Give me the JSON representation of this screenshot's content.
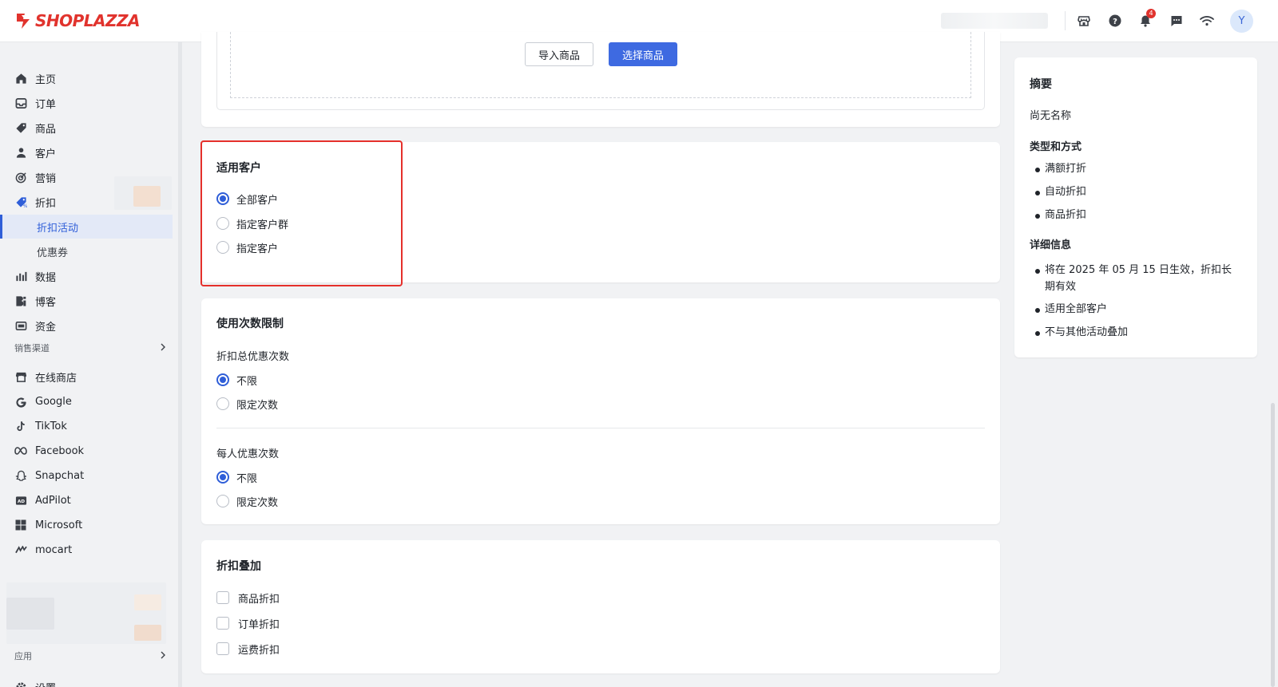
{
  "app": {
    "logo_text": "SHOPLAZZA",
    "brand_color": "#e1332d",
    "accent_color": "#2f5ed8"
  },
  "topbar": {
    "icons": [
      "store-icon",
      "help-icon",
      "bell-icon",
      "chat-icon",
      "wifi-icon"
    ],
    "notification_count": "4",
    "avatar_initial": "Y"
  },
  "sidebar": {
    "items": [
      {
        "label": "主页",
        "icon": "home-icon"
      },
      {
        "label": "订单",
        "icon": "inbox-icon"
      },
      {
        "label": "商品",
        "icon": "tag-icon"
      },
      {
        "label": "客户",
        "icon": "person-icon"
      },
      {
        "label": "营销",
        "icon": "target-icon"
      },
      {
        "label": "折扣",
        "icon": "discount-icon"
      }
    ],
    "sub_items": [
      {
        "label": "折扣活动",
        "active": true
      },
      {
        "label": "优惠券",
        "active": false
      }
    ],
    "items2": [
      {
        "label": "数据",
        "icon": "bar-chart-icon"
      },
      {
        "label": "博客",
        "icon": "blog-icon"
      },
      {
        "label": "资金",
        "icon": "wallet-icon"
      }
    ],
    "sales_channels_label": "销售渠道",
    "channels": [
      {
        "label": "在线商店",
        "icon": "store-icon"
      },
      {
        "label": "Google",
        "icon": "google-icon"
      },
      {
        "label": "TikTok",
        "icon": "tiktok-icon"
      },
      {
        "label": "Facebook",
        "icon": "meta-icon"
      },
      {
        "label": "Snapchat",
        "icon": "ghost-icon"
      },
      {
        "label": "AdPilot",
        "icon": "ad-icon"
      },
      {
        "label": "Microsoft",
        "icon": "windows-icon"
      },
      {
        "label": "mocart",
        "icon": "mocart-icon"
      }
    ],
    "apps_label": "应用",
    "settings_label": "设置"
  },
  "product_card": {
    "import_button": "导入商品",
    "select_button": "选择商品"
  },
  "customers": {
    "title": "适用客户",
    "options": [
      {
        "label": "全部客户",
        "selected": true
      },
      {
        "label": "指定客户群",
        "selected": false
      },
      {
        "label": "指定客户",
        "selected": false
      }
    ]
  },
  "usage_limit": {
    "title": "使用次数限制",
    "total_label": "折扣总优惠次数",
    "total_options": [
      {
        "label": "不限",
        "selected": true
      },
      {
        "label": "限定次数",
        "selected": false
      }
    ],
    "per_person_label": "每人优惠次数",
    "per_person_options": [
      {
        "label": "不限",
        "selected": true
      },
      {
        "label": "限定次数",
        "selected": false
      }
    ]
  },
  "stacking": {
    "title": "折扣叠加",
    "options": [
      "商品折扣",
      "订单折扣",
      "运费折扣"
    ]
  },
  "summary": {
    "title": "摘要",
    "name": "尚无名称",
    "type_heading": "类型和方式",
    "type_items": [
      "满额打折",
      "自动折扣",
      "商品折扣"
    ],
    "detail_heading": "详细信息",
    "detail_line1": "将在 2025 年 05 月 15 日生效，折扣长",
    "detail_line2": "期有效",
    "detail_items": [
      "适用全部客户",
      "不与其他活动叠加"
    ]
  }
}
